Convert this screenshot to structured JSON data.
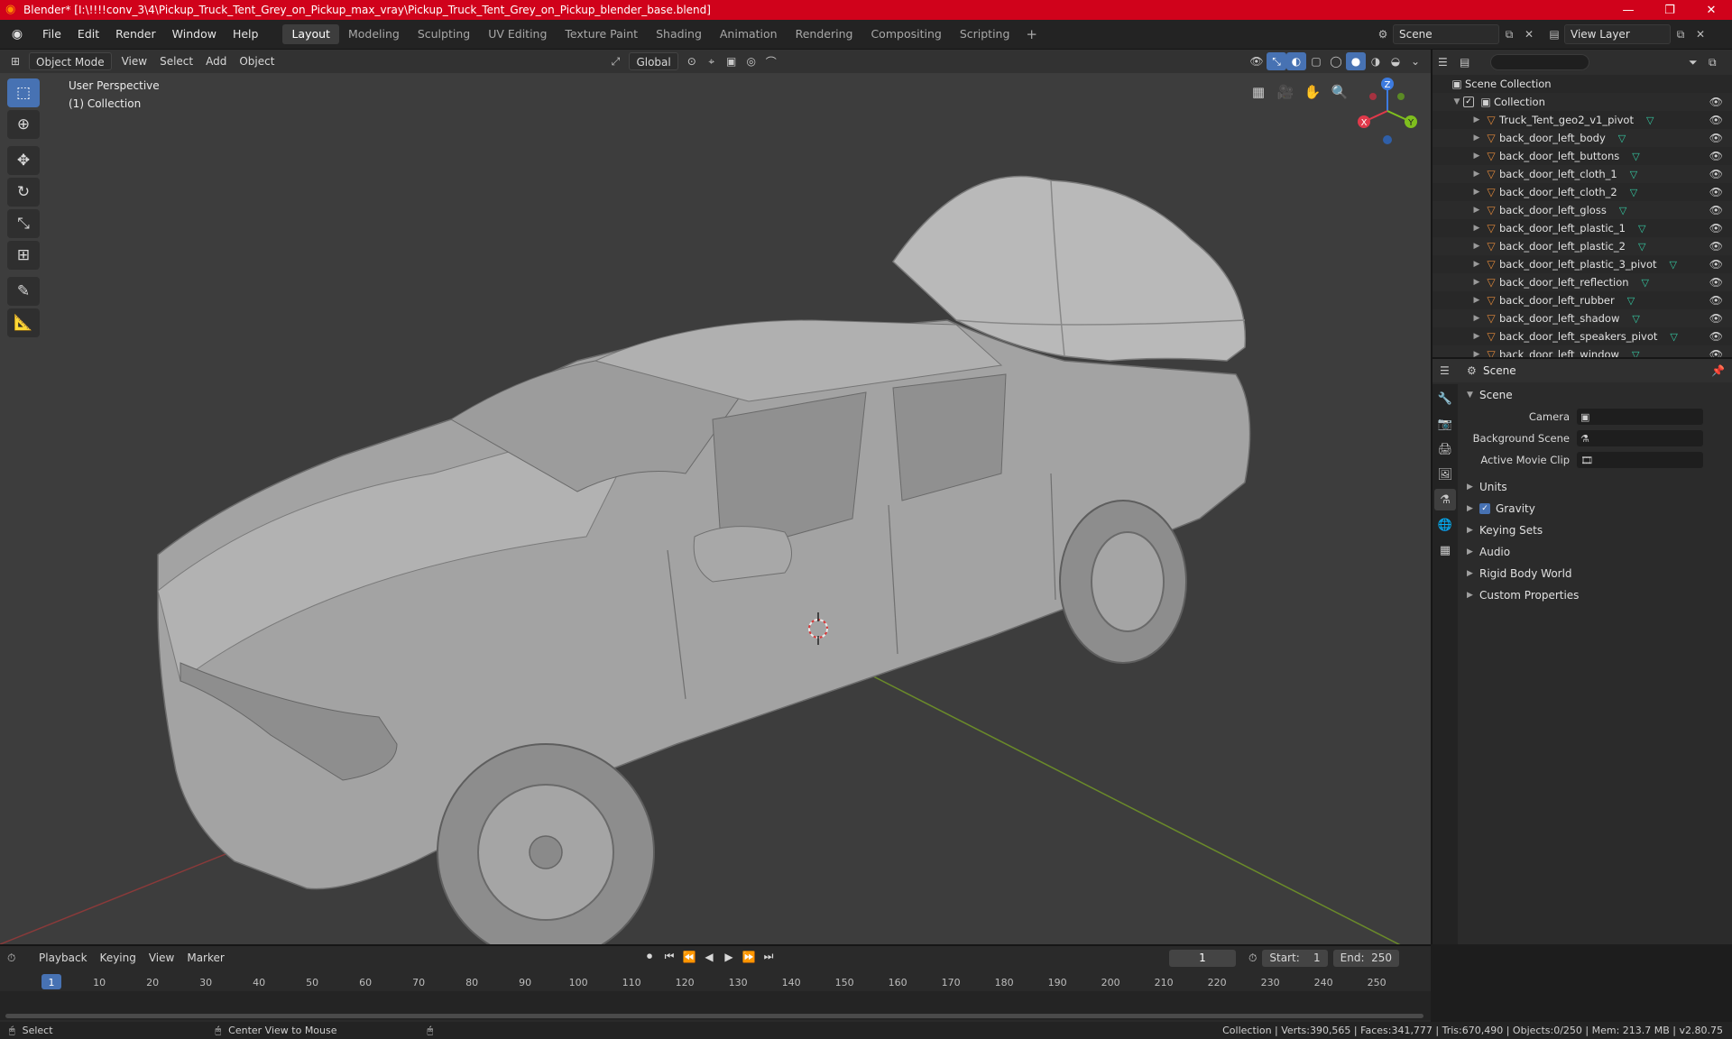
{
  "titlebar": {
    "title": "Blender* [I:\\!!!!conv_3\\4\\Pickup_Truck_Tent_Grey_on_Pickup_max_vray\\Pickup_Truck_Tent_Grey_on_Pickup_blender_base.blend]",
    "minimize": "—",
    "maximize": "❐",
    "close": "✕"
  },
  "menu": {
    "items": [
      "File",
      "Edit",
      "Render",
      "Window",
      "Help"
    ]
  },
  "workspaces": {
    "tabs": [
      "Layout",
      "Modeling",
      "Sculpting",
      "UV Editing",
      "Texture Paint",
      "Shading",
      "Animation",
      "Rendering",
      "Compositing",
      "Scripting"
    ],
    "active": "Layout",
    "add": "+"
  },
  "scene_selector": {
    "scene": "Scene",
    "view_layer": "View Layer"
  },
  "viewport": {
    "mode": "Object Mode",
    "menus": [
      "View",
      "Select",
      "Add",
      "Object"
    ],
    "transform_orientation": "Global",
    "info_line1": "User Perspective",
    "info_line2": "(1) Collection",
    "gizmo": {
      "z": "Z",
      "y": "Y",
      "x": "X"
    }
  },
  "outliner": {
    "search_placeholder": "",
    "root": "Scene Collection",
    "collection": "Collection",
    "objects": [
      "Truck_Tent_geo2_v1_pivot",
      "back_door_left_body",
      "back_door_left_buttons",
      "back_door_left_cloth_1",
      "back_door_left_cloth_2",
      "back_door_left_gloss",
      "back_door_left_plastic_1",
      "back_door_left_plastic_2",
      "back_door_left_plastic_3_pivot",
      "back_door_left_reflection",
      "back_door_left_rubber",
      "back_door_left_shadow",
      "back_door_left_speakers_pivot",
      "back_door_left_window"
    ]
  },
  "properties": {
    "header": "Scene",
    "section": "Scene",
    "fields": [
      {
        "label": "Camera",
        "value": ""
      },
      {
        "label": "Background Scene",
        "value": ""
      },
      {
        "label": "Active Movie Clip",
        "value": ""
      }
    ],
    "subsections": [
      "Units",
      "Gravity",
      "Keying Sets",
      "Audio",
      "Rigid Body World",
      "Custom Properties"
    ],
    "gravity_checked": true
  },
  "timeline": {
    "menus": [
      "Playback",
      "Keying",
      "View",
      "Marker"
    ],
    "current_frame": "1",
    "start_label": "Start:",
    "start": "1",
    "end_label": "End:",
    "end": "250",
    "ticks": [
      "1",
      "10",
      "20",
      "30",
      "40",
      "50",
      "60",
      "70",
      "80",
      "90",
      "100",
      "110",
      "120",
      "130",
      "140",
      "150",
      "160",
      "170",
      "180",
      "190",
      "200",
      "210",
      "220",
      "230",
      "240",
      "250"
    ]
  },
  "statusbar": {
    "select": "Select",
    "center": "Center View to Mouse",
    "stats": "Collection | Verts:390,565 | Faces:341,777 | Tris:670,490 | Objects:0/250 | Mem: 213.7 MB | v2.80.75"
  }
}
